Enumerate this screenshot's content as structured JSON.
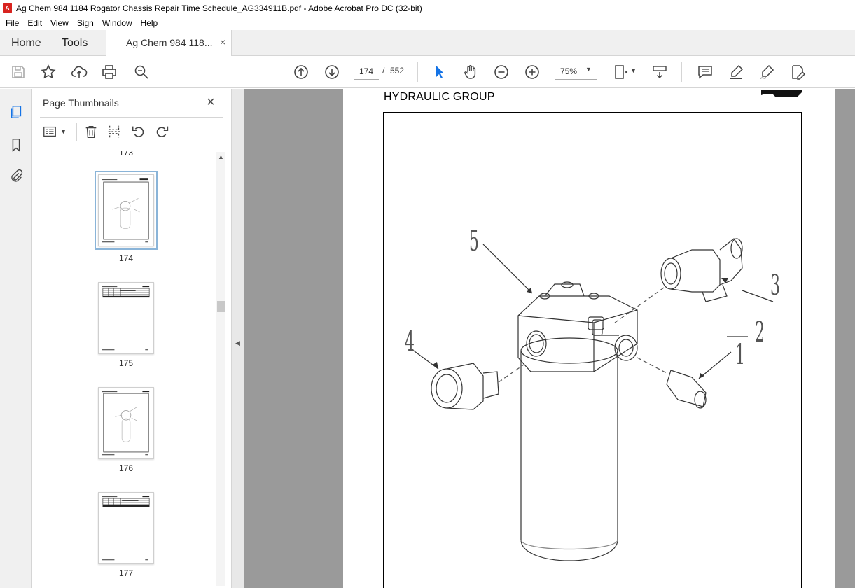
{
  "window": {
    "title": "Ag Chem 984 1184 Rogator Chassis Repair Time Schedule_AG334911B.pdf - Adobe Acrobat Pro DC (32-bit)"
  },
  "menu": [
    "File",
    "Edit",
    "View",
    "Sign",
    "Window",
    "Help"
  ],
  "tabs": {
    "home": "Home",
    "tools": "Tools",
    "document": "Ag Chem 984 118...",
    "close": "×"
  },
  "toolbar": {
    "current_page": "174",
    "separator": "/",
    "total_pages": "552",
    "zoom": "75%"
  },
  "thumbnails_panel": {
    "title": "Page Thumbnails",
    "close": "×",
    "partial_label": "173",
    "items": [
      {
        "number": "174",
        "selected": true
      },
      {
        "number": "175",
        "selected": false
      },
      {
        "number": "176",
        "selected": false
      },
      {
        "number": "177",
        "selected": false
      }
    ]
  },
  "document": {
    "heading": "HYDRAULIC GROUP",
    "callouts": [
      "1",
      "2",
      "3",
      "4",
      "5"
    ]
  },
  "colors": {
    "accent_blue": "#1473e6",
    "select_blue": "#8ab4d8",
    "doc_background": "#9a9a9a"
  }
}
